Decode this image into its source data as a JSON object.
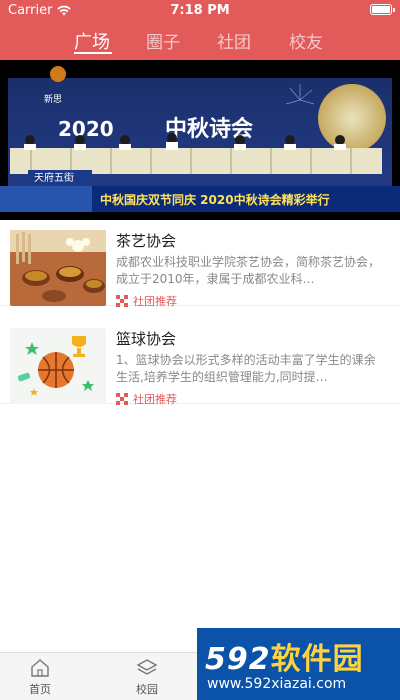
{
  "status_bar": {
    "carrier": "Carrier",
    "time": "7:18 PM"
  },
  "tabs": [
    {
      "label": "广场",
      "active": true
    },
    {
      "label": "圈子",
      "active": false
    },
    {
      "label": "社团",
      "active": false
    },
    {
      "label": "校友",
      "active": false
    }
  ],
  "banner": {
    "year_text": "2020",
    "stage_text": "中秋诗会",
    "caption": "中秋国庆双节同庆   2020中秋诗会精彩举行",
    "station_label": "天府五街"
  },
  "list": [
    {
      "title": "茶艺协会",
      "description": "成都农业科技职业学院茶艺协会，简称茶艺协会，成立于2010年，隶属于成都农业科…",
      "tag": "社团推荐"
    },
    {
      "title": "篮球协会",
      "description": "1、篮球协会以形式多样的活动丰富了学生的课余生活,培养学生的组织管理能力,同时提…",
      "tag": "社团推荐"
    }
  ],
  "tabbar": [
    {
      "label": "首页",
      "icon": "home-icon"
    },
    {
      "label": "校园",
      "icon": "layers-icon"
    }
  ],
  "watermark": {
    "logo_number": "592",
    "logo_text": "软件园",
    "url": "www.592xiazai.com"
  },
  "colors": {
    "accent": "#e25a5a",
    "watermark_blue": "#0b53a8"
  }
}
